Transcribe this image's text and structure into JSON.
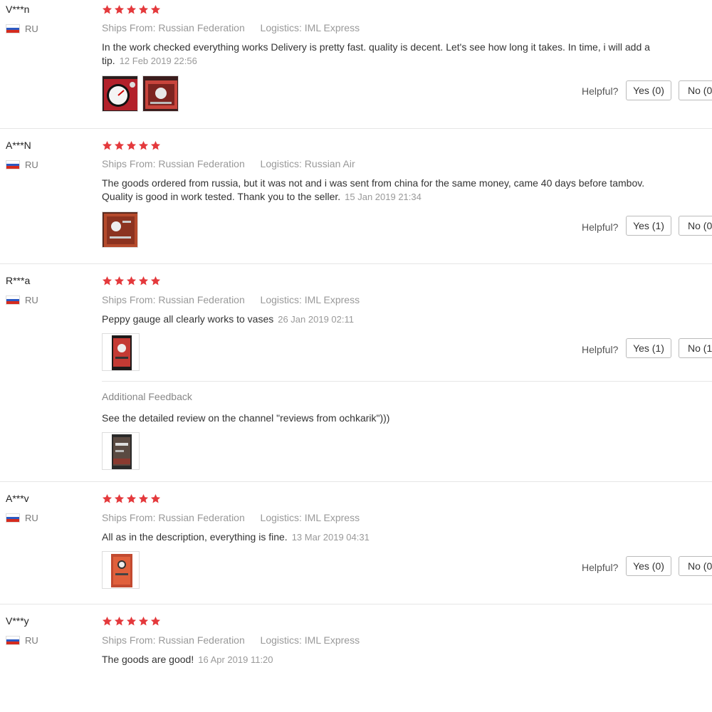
{
  "labels": {
    "ships_from": "Ships From:",
    "logistics": "Logistics:",
    "helpful": "Helpful?",
    "additional_feedback": "Additional Feedback"
  },
  "colors": {
    "star": "#e4393c",
    "flag_white": "#ffffff",
    "flag_blue": "#2b59c3",
    "flag_red": "#d52b1e"
  },
  "reviews": [
    {
      "user": "V***n",
      "country": "RU",
      "rating": 5,
      "ships_from": "Russian Federation",
      "logistics": "IML Express",
      "text": "In the work checked everything works Delivery is pretty fast. quality is decent. Let's see how long it takes. In time, i will add a tip.",
      "date": "12 Feb 2019 22:56",
      "yes": "Yes (0)",
      "no": "No (0"
    },
    {
      "user": "A***N",
      "country": "RU",
      "rating": 5,
      "ships_from": "Russian Federation",
      "logistics": "Russian Air",
      "text": "The goods ordered from russia, but it was not and i was sent from china for the same money, came 40 days before tambov. Quality is good in work tested. Thank you to the seller.",
      "date": "15 Jan 2019 21:34",
      "yes": "Yes (1)",
      "no": "No (0"
    },
    {
      "user": "R***a",
      "country": "RU",
      "rating": 5,
      "ships_from": "Russian Federation",
      "logistics": "IML Express",
      "text": "Peppy gauge all clearly works to vases",
      "date": "26 Jan 2019 02:11",
      "yes": "Yes (1)",
      "no": "No (1",
      "additional_feedback_text": "See the detailed review on the channel \"reviews from ochkarik\")))"
    },
    {
      "user": "A***v",
      "country": "RU",
      "rating": 5,
      "ships_from": "Russian Federation",
      "logistics": "IML Express",
      "text": "All as in the description, everything is fine.",
      "date": "13 Mar 2019 04:31",
      "yes": "Yes (0)",
      "no": "No (0"
    },
    {
      "user": "V***y",
      "country": "RU",
      "rating": 5,
      "ships_from": "Russian Federation",
      "logistics": "IML Express",
      "text": "The goods are good!",
      "date": "16 Apr 2019 11:20"
    }
  ]
}
